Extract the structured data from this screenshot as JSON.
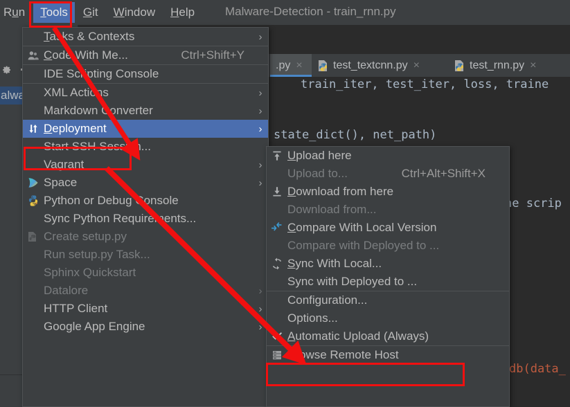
{
  "window": {
    "title": "Malware-Detection - train_rnn.py"
  },
  "menubar": {
    "items": [
      {
        "label": "Run",
        "mnemonic": "u",
        "selected": false
      },
      {
        "label": "Tools",
        "mnemonic": "T",
        "selected": true
      },
      {
        "label": "Git",
        "mnemonic": "G",
        "selected": false
      },
      {
        "label": "Window",
        "mnemonic": "W",
        "selected": false
      },
      {
        "label": "Help",
        "mnemonic": "H",
        "selected": false
      }
    ]
  },
  "left_panel": {
    "gear_icon": "gear-icon",
    "minimize_icon": "minimize-icon",
    "tree_item": "alwa"
  },
  "editor": {
    "tabs": [
      {
        "label": ".py",
        "icon": "python-file-icon",
        "active": true,
        "close": "×"
      },
      {
        "label": "test_textcnn.py",
        "icon": "python-file-icon",
        "active": false,
        "close": "×"
      },
      {
        "label": "test_rnn.py",
        "icon": "python-file-icon",
        "active": false,
        "close": "×"
      }
    ],
    "code": {
      "line1": "train_iter, test_iter, loss, traine",
      "line2": "state_dict(), net_path)",
      "line3": "he scrip",
      "line4": "db(data_"
    }
  },
  "tools_menu": {
    "name": "tools-menu",
    "items": [
      {
        "label": "Tasks & Contexts",
        "mnemonic": "T",
        "icon": null,
        "accel": "",
        "submenu": true,
        "disabled": false,
        "highlight": false,
        "sep_after": true
      },
      {
        "label": "Code With Me...",
        "mnemonic": "C",
        "icon": "code-with-me-icon",
        "accel": "Ctrl+Shift+Y",
        "submenu": false,
        "disabled": false,
        "highlight": false,
        "sep_after": true
      },
      {
        "label": "IDE Scripting Console",
        "mnemonic": "",
        "icon": null,
        "accel": "",
        "submenu": false,
        "disabled": false,
        "highlight": false,
        "sep_after": true
      },
      {
        "label": "XML Actions",
        "mnemonic": "",
        "icon": null,
        "accel": "",
        "submenu": true,
        "disabled": false,
        "highlight": false,
        "sep_after": false
      },
      {
        "label": "Markdown Converter",
        "mnemonic": "",
        "icon": null,
        "accel": "",
        "submenu": true,
        "disabled": false,
        "highlight": false,
        "sep_after": false
      },
      {
        "label": "Deployment",
        "mnemonic": "D",
        "icon": "deployment-icon",
        "accel": "",
        "submenu": true,
        "disabled": false,
        "highlight": true,
        "sep_after": false
      },
      {
        "label": "Start SSH Session...",
        "mnemonic": "",
        "icon": null,
        "accel": "",
        "submenu": false,
        "disabled": false,
        "highlight": false,
        "sep_after": false
      },
      {
        "label": "Vagrant",
        "mnemonic": "",
        "icon": null,
        "accel": "",
        "submenu": true,
        "disabled": false,
        "highlight": false,
        "sep_after": false
      },
      {
        "label": "Space",
        "mnemonic": "",
        "icon": "space-icon",
        "accel": "",
        "submenu": true,
        "disabled": false,
        "highlight": false,
        "sep_after": false
      },
      {
        "label": "Python or Debug Console",
        "mnemonic": "",
        "icon": "python-icon",
        "accel": "",
        "submenu": false,
        "disabled": false,
        "highlight": false,
        "sep_after": false
      },
      {
        "label": "Sync Python Requirements...",
        "mnemonic": "",
        "icon": null,
        "accel": "",
        "submenu": false,
        "disabled": false,
        "highlight": false,
        "sep_after": false
      },
      {
        "label": "Create setup.py",
        "mnemonic": "",
        "icon": "python-setup-icon",
        "accel": "",
        "submenu": false,
        "disabled": true,
        "highlight": false,
        "sep_after": false
      },
      {
        "label": "Run setup.py Task...",
        "mnemonic": "",
        "icon": null,
        "accel": "",
        "submenu": false,
        "disabled": true,
        "highlight": false,
        "sep_after": false
      },
      {
        "label": "Sphinx Quickstart",
        "mnemonic": "",
        "icon": null,
        "accel": "",
        "submenu": false,
        "disabled": true,
        "highlight": false,
        "sep_after": false
      },
      {
        "label": "Datalore",
        "mnemonic": "",
        "icon": null,
        "accel": "",
        "submenu": true,
        "disabled": true,
        "highlight": false,
        "sep_after": false
      },
      {
        "label": "HTTP Client",
        "mnemonic": "",
        "icon": null,
        "accel": "",
        "submenu": true,
        "disabled": false,
        "highlight": false,
        "sep_after": false
      },
      {
        "label": "Google App Engine",
        "mnemonic": "",
        "icon": null,
        "accel": "",
        "submenu": true,
        "disabled": false,
        "highlight": false,
        "sep_after": false
      }
    ]
  },
  "deployment_submenu": {
    "name": "deployment-submenu",
    "items": [
      {
        "label": "Upload here",
        "mnemonic": "U",
        "icon": "upload-icon",
        "accel": "",
        "check": false,
        "disabled": false,
        "highlight": false,
        "sep_after": false
      },
      {
        "label": "Upload to...",
        "mnemonic": "",
        "icon": null,
        "accel": "Ctrl+Alt+Shift+X",
        "check": false,
        "disabled": true,
        "highlight": false,
        "sep_after": false
      },
      {
        "label": "Download from here",
        "mnemonic": "D",
        "icon": "download-icon",
        "accel": "",
        "check": false,
        "disabled": false,
        "highlight": false,
        "sep_after": false
      },
      {
        "label": "Download from...",
        "mnemonic": "",
        "icon": null,
        "accel": "",
        "check": false,
        "disabled": true,
        "highlight": false,
        "sep_after": false
      },
      {
        "label": "Compare With Local Version",
        "mnemonic": "C",
        "icon": "compare-icon",
        "accel": "",
        "check": false,
        "disabled": false,
        "highlight": false,
        "sep_after": false
      },
      {
        "label": "Compare with Deployed to ...",
        "mnemonic": "",
        "icon": null,
        "accel": "",
        "check": false,
        "disabled": true,
        "highlight": false,
        "sep_after": false
      },
      {
        "label": "Sync With Local...",
        "mnemonic": "S",
        "icon": "sync-icon",
        "accel": "",
        "check": false,
        "disabled": false,
        "highlight": false,
        "sep_after": false
      },
      {
        "label": "Sync with Deployed to ...",
        "mnemonic": "",
        "icon": null,
        "accel": "",
        "check": false,
        "disabled": false,
        "highlight": false,
        "sep_after": true
      },
      {
        "label": "Configuration...",
        "mnemonic": "",
        "icon": null,
        "accel": "",
        "check": false,
        "disabled": false,
        "highlight": false,
        "sep_after": false
      },
      {
        "label": "Options...",
        "mnemonic": "",
        "icon": null,
        "accel": "",
        "check": false,
        "disabled": false,
        "highlight": false,
        "sep_after": false
      },
      {
        "label": "Automatic Upload (Always)",
        "mnemonic": "A",
        "icon": null,
        "accel": "",
        "check": true,
        "disabled": false,
        "highlight": false,
        "sep_after": true
      },
      {
        "label": "Browse Remote Host",
        "mnemonic": "",
        "icon": "remote-host-icon",
        "accel": "",
        "check": false,
        "disabled": false,
        "highlight": false,
        "sep_after": false
      }
    ]
  },
  "annotations": {
    "accent_color": "#f01010",
    "boxes": [
      {
        "name": "tools-menu-highlight-box"
      },
      {
        "name": "deployment-highlight-box"
      },
      {
        "name": "automatic-upload-highlight-box"
      }
    ],
    "arrows": [
      {
        "name": "arrow-tools-to-deployment"
      },
      {
        "name": "arrow-deployment-to-automatic-upload"
      }
    ]
  }
}
